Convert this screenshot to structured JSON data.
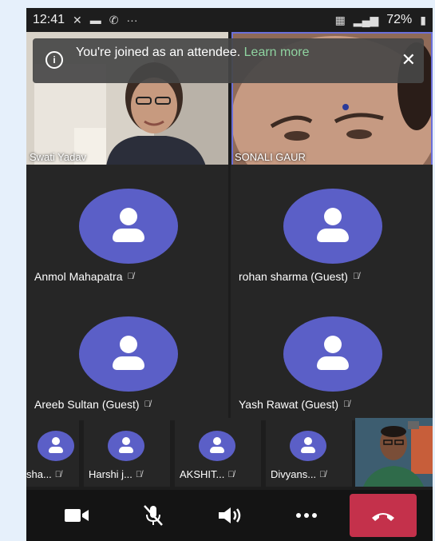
{
  "status_bar": {
    "time": "12:41",
    "icons_left": [
      "missed-call-icon",
      "gallery-icon",
      "call-icon",
      "more-dots-icon"
    ],
    "battery": "72%"
  },
  "notice": {
    "text": "You're joined as an attendee. ",
    "link": "Learn more"
  },
  "video_tiles": [
    {
      "name": "Swati Yadav"
    },
    {
      "name": "SONALI GAUR"
    }
  ],
  "participants": [
    {
      "name": "Anmol Mahapatra"
    },
    {
      "name": "rohan sharma (Guest)"
    },
    {
      "name": "Areeb Sultan (Guest)"
    },
    {
      "name": "Yash Rawat (Guest)"
    }
  ],
  "strip": [
    {
      "name": "sha..."
    },
    {
      "name": "Harshi j..."
    },
    {
      "name": "AKSHIT..."
    },
    {
      "name": "Divyans..."
    }
  ],
  "controls": [
    "camera",
    "mute",
    "speaker",
    "more",
    "end-call"
  ],
  "colors": {
    "avatar": "#5b5fc7",
    "end_call": "#c4314b",
    "link": "#8fd3a0"
  }
}
